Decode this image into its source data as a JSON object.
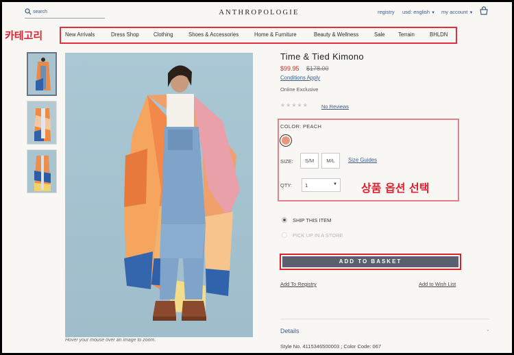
{
  "header": {
    "search_label": "search",
    "brand": "ANTHROPOLOGIE",
    "registry": "registry",
    "currency": "usd: english",
    "account": "my account",
    "icons": {
      "search": "search-icon",
      "basket": "basket-icon",
      "chevron": "chevron-down-icon"
    }
  },
  "annotations": {
    "category": "카테고리",
    "options": "상품 옵션 선택"
  },
  "nav": {
    "items": [
      "New Arrivals",
      "Dress Shop",
      "Clothing",
      "Shoes & Accessories",
      "Home & Furniture",
      "Beauty & Wellness",
      "Sale",
      "Terrain",
      "BHLDN"
    ]
  },
  "gallery": {
    "caption": "Hover your mouse over an image to zoom."
  },
  "product": {
    "title": "Time & Tied Kimono",
    "sale_price": "$99.95",
    "original_price": "$178.00",
    "conditions": "Conditions Apply",
    "exclusive": "Online Exclusive",
    "stars": "★★★★★",
    "reviews": "No Reviews",
    "color_label": "COLOR: PEACH",
    "swatch_color": "#e9977c",
    "size_label": "SIZE:",
    "sizes": [
      "S/M",
      "M/L"
    ],
    "size_guides": "Size Guides",
    "qty_label": "QTY:",
    "qty_value": "1",
    "ship_label": "SHIP THIS ITEM",
    "pickup_label": "PICK UP IN A STORE",
    "add_to_basket": "ADD TO BASKET",
    "add_to_registry": "Add To Registry",
    "add_to_wishlist": "Add to Wish List",
    "details_label": "Details",
    "style_info": "Style No. 4115346500003 ; Color Code: 067"
  },
  "colors": {
    "accent_link": "#3b5b86",
    "sale_red": "#c8302c",
    "annotation_red": "#e0202e",
    "basket_button": "#5b5f70"
  }
}
